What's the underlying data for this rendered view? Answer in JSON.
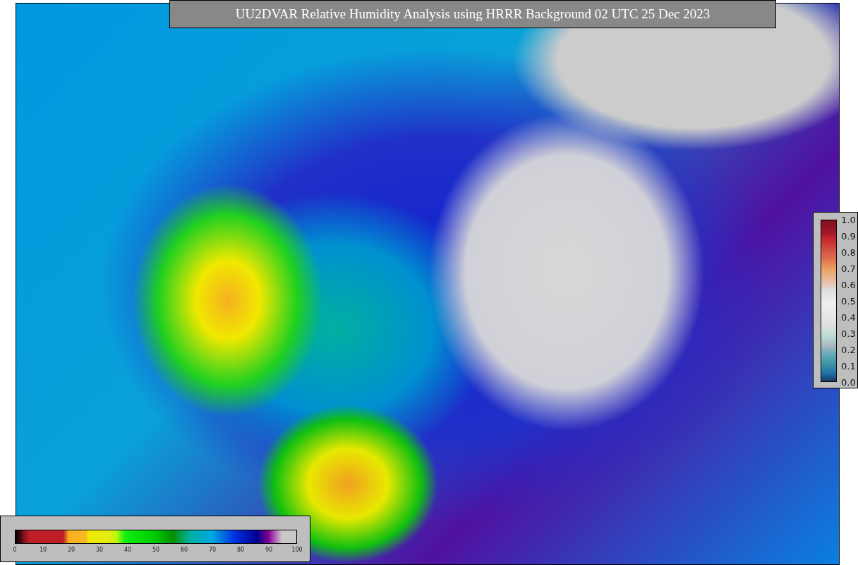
{
  "title": "UU2DVAR Relative Humidity Analysis using HRRR Background 02 UTC 25 Dec 2023",
  "humidity_colorbar": {
    "ticks": [
      "0",
      "10",
      "20",
      "30",
      "40",
      "50",
      "60",
      "70",
      "80",
      "90",
      "100"
    ]
  },
  "observation_colorbar": {
    "ticks": [
      "1.0",
      "0.9",
      "0.8",
      "0.7",
      "0.6",
      "0.5",
      "0.4",
      "0.3",
      "0.2",
      "0.1",
      "0.0"
    ]
  }
}
